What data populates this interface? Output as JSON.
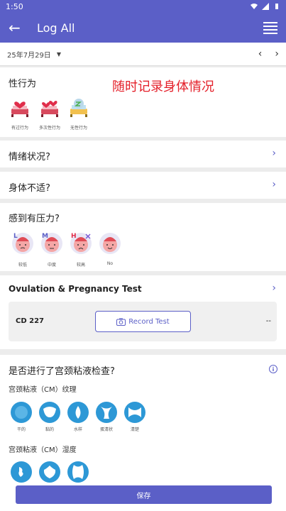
{
  "statusbar": {
    "time": "1:50"
  },
  "appbar": {
    "title": "Log All"
  },
  "datebar": {
    "date": "25年7月29日"
  },
  "overlay": {
    "text": "随时记录身体情况"
  },
  "sex": {
    "title": "性行为",
    "items": [
      {
        "label": "有过行为"
      },
      {
        "label": "多次性行为"
      },
      {
        "label": "无性行为"
      }
    ]
  },
  "mood": {
    "title": "情绪状况?"
  },
  "discomfort": {
    "title": "身体不适?"
  },
  "stress": {
    "title": "感到有压力?",
    "items": [
      {
        "badge": "L",
        "label": "较低"
      },
      {
        "badge": "M",
        "label": "中度"
      },
      {
        "badge": "H",
        "label": "较高"
      },
      {
        "badge": "",
        "label": "No"
      }
    ]
  },
  "ovulation": {
    "title": "Ovulation & Pregnancy Test",
    "cd": "CD 227",
    "record_label": "Record Test",
    "value": "--"
  },
  "cervical": {
    "title": "是否进行了宫颈粘液检查?",
    "texture_title": "宫颈粘液（CM）纹理",
    "texture_items": [
      {
        "label": "干的"
      },
      {
        "label": "黏的"
      },
      {
        "label": "水样"
      },
      {
        "label": "蛋清状"
      },
      {
        "label": "清楚"
      }
    ],
    "wetness_title": "宫颈粘液（CM）湿度"
  },
  "save": {
    "label": "保存"
  }
}
